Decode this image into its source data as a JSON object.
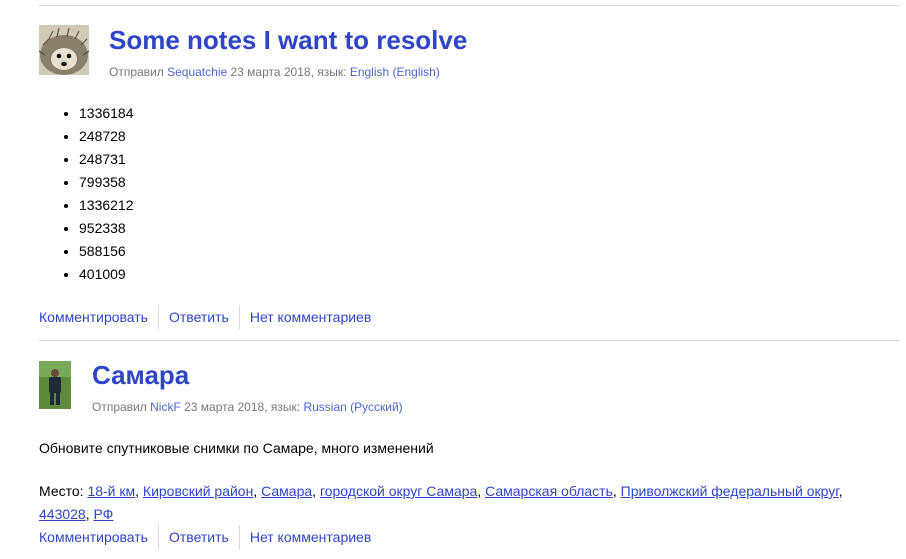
{
  "posts": [
    {
      "title": "Some notes I want to resolve",
      "meta": {
        "prefix": "Отправил",
        "author": "Sequatchie",
        "date": "23 марта 2018, язык:",
        "language": "English (English)"
      },
      "avatar_icon": "hedgehog-avatar",
      "list": [
        "1336184",
        "248728",
        "248731",
        "799358",
        "1336212",
        "952338",
        "588156",
        "401009"
      ],
      "actions": {
        "comment": "Комментировать",
        "reply": "Ответить",
        "no_comments": "Нет комментариев"
      }
    },
    {
      "title": "Самара",
      "meta": {
        "prefix": "Отправил",
        "author": "NickF",
        "date": "23 марта 2018, язык:",
        "language": "Russian (Русский)"
      },
      "avatar_icon": "person-avatar",
      "text": "Обновите спутниковые снимки по Самаре, много изменений",
      "place": {
        "label": "Место:",
        "links": [
          "18-й км",
          "Кировский район",
          "Самара",
          "городской округ Самара",
          "Самарская область",
          "Приволжский федеральный округ",
          "443028",
          "РФ"
        ]
      },
      "actions": {
        "comment": "Комментировать",
        "reply": "Ответить",
        "no_comments": "Нет комментариев"
      }
    }
  ],
  "colors": {
    "link": "#2f45c6",
    "meta_link": "#4b68c9",
    "meta_text": "#777777",
    "divider": "#d9d9d9"
  }
}
